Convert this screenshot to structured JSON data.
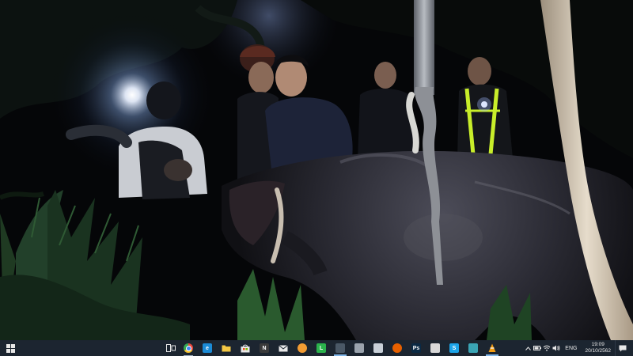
{
  "wallpaper": {
    "subject": "night-rescue-photo"
  },
  "taskbar": {
    "background_color": "#1c2530",
    "start_icon": "windows-logo-icon",
    "task_view_icon": "task-view-icon",
    "apps": [
      {
        "name": "chrome",
        "icon": "chrome-icon",
        "color": "#e8453c",
        "glyph": "",
        "state": "running"
      },
      {
        "name": "edge",
        "icon": "edge-icon",
        "color": "#1b8bd6",
        "glyph": "e",
        "state": "none"
      },
      {
        "name": "file-explorer",
        "icon": "folder-icon",
        "color": "#f2c744",
        "glyph": "",
        "state": "none"
      },
      {
        "name": "store",
        "icon": "store-icon",
        "color": "#e8e8e8",
        "glyph": "",
        "state": "none"
      },
      {
        "name": "app-n",
        "icon": "n-app-icon",
        "color": "#3a3a3a",
        "glyph": "N",
        "state": "none"
      },
      {
        "name": "mail",
        "icon": "mail-icon",
        "color": "#e8e8e8",
        "glyph": "",
        "state": "none"
      },
      {
        "name": "orange-app",
        "icon": "orange-circle-icon",
        "color": "#f39c33",
        "glyph": "",
        "state": "none"
      },
      {
        "name": "line",
        "icon": "line-icon",
        "color": "#2bb24c",
        "glyph": "L",
        "state": "none"
      },
      {
        "name": "media-app",
        "icon": "media-icon",
        "color": "#4a5866",
        "glyph": "",
        "state": "active"
      },
      {
        "name": "app-gray",
        "icon": "gray-app-icon",
        "color": "#9aa3ad",
        "glyph": "",
        "state": "none"
      },
      {
        "name": "app-bird",
        "icon": "bird-app-icon",
        "color": "#c8d0d8",
        "glyph": "",
        "state": "none"
      },
      {
        "name": "firefox",
        "icon": "firefox-icon",
        "color": "#e66000",
        "glyph": "",
        "state": "none"
      },
      {
        "name": "photoshop",
        "icon": "photoshop-icon",
        "color": "#0b2a44",
        "glyph": "Ps",
        "state": "none"
      },
      {
        "name": "app-white",
        "icon": "tool-app-icon",
        "color": "#d8d8d8",
        "glyph": "",
        "state": "none"
      },
      {
        "name": "skype",
        "icon": "skype-icon",
        "color": "#1ca4e8",
        "glyph": "S",
        "state": "none"
      },
      {
        "name": "app-teal",
        "icon": "teal-app-icon",
        "color": "#3aa5b5",
        "glyph": "",
        "state": "none"
      },
      {
        "name": "vlc",
        "icon": "vlc-cone-icon",
        "color": "#f39c12",
        "glyph": "",
        "state": "active"
      }
    ],
    "tray": {
      "chevron_icon": "chevron-up-icon",
      "battery_icon": "battery-icon",
      "wifi_icon": "wifi-icon",
      "volume_icon": "volume-icon",
      "language": "ENG",
      "time": "19:09",
      "date": "20/10/2562",
      "notification_icon": "notification-icon"
    }
  }
}
